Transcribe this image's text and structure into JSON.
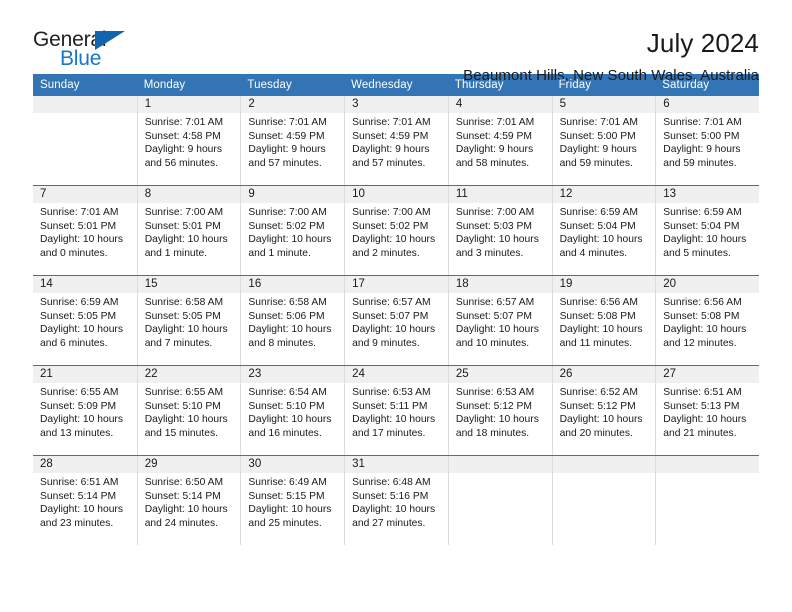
{
  "logo": {
    "word_top": "General",
    "word_bottom": "Blue",
    "triangle_color": "#1164ad",
    "blue_text_color": "#1878c8"
  },
  "header": {
    "month_title": "July 2024",
    "location": "Beaumont Hills, New South Wales, Australia",
    "header_bg_color": "#3274b4"
  },
  "weekdays": [
    "Sunday",
    "Monday",
    "Tuesday",
    "Wednesday",
    "Thursday",
    "Friday",
    "Saturday"
  ],
  "weeks": [
    [
      {
        "day": "",
        "info": ""
      },
      {
        "day": "1",
        "info": "Sunrise: 7:01 AM\nSunset: 4:58 PM\nDaylight: 9 hours\nand 56 minutes."
      },
      {
        "day": "2",
        "info": "Sunrise: 7:01 AM\nSunset: 4:59 PM\nDaylight: 9 hours\nand 57 minutes."
      },
      {
        "day": "3",
        "info": "Sunrise: 7:01 AM\nSunset: 4:59 PM\nDaylight: 9 hours\nand 57 minutes."
      },
      {
        "day": "4",
        "info": "Sunrise: 7:01 AM\nSunset: 4:59 PM\nDaylight: 9 hours\nand 58 minutes."
      },
      {
        "day": "5",
        "info": "Sunrise: 7:01 AM\nSunset: 5:00 PM\nDaylight: 9 hours\nand 59 minutes."
      },
      {
        "day": "6",
        "info": "Sunrise: 7:01 AM\nSunset: 5:00 PM\nDaylight: 9 hours\nand 59 minutes."
      }
    ],
    [
      {
        "day": "7",
        "info": "Sunrise: 7:01 AM\nSunset: 5:01 PM\nDaylight: 10 hours\nand 0 minutes."
      },
      {
        "day": "8",
        "info": "Sunrise: 7:00 AM\nSunset: 5:01 PM\nDaylight: 10 hours\nand 1 minute."
      },
      {
        "day": "9",
        "info": "Sunrise: 7:00 AM\nSunset: 5:02 PM\nDaylight: 10 hours\nand 1 minute."
      },
      {
        "day": "10",
        "info": "Sunrise: 7:00 AM\nSunset: 5:02 PM\nDaylight: 10 hours\nand 2 minutes."
      },
      {
        "day": "11",
        "info": "Sunrise: 7:00 AM\nSunset: 5:03 PM\nDaylight: 10 hours\nand 3 minutes."
      },
      {
        "day": "12",
        "info": "Sunrise: 6:59 AM\nSunset: 5:04 PM\nDaylight: 10 hours\nand 4 minutes."
      },
      {
        "day": "13",
        "info": "Sunrise: 6:59 AM\nSunset: 5:04 PM\nDaylight: 10 hours\nand 5 minutes."
      }
    ],
    [
      {
        "day": "14",
        "info": "Sunrise: 6:59 AM\nSunset: 5:05 PM\nDaylight: 10 hours\nand 6 minutes."
      },
      {
        "day": "15",
        "info": "Sunrise: 6:58 AM\nSunset: 5:05 PM\nDaylight: 10 hours\nand 7 minutes."
      },
      {
        "day": "16",
        "info": "Sunrise: 6:58 AM\nSunset: 5:06 PM\nDaylight: 10 hours\nand 8 minutes."
      },
      {
        "day": "17",
        "info": "Sunrise: 6:57 AM\nSunset: 5:07 PM\nDaylight: 10 hours\nand 9 minutes."
      },
      {
        "day": "18",
        "info": "Sunrise: 6:57 AM\nSunset: 5:07 PM\nDaylight: 10 hours\nand 10 minutes."
      },
      {
        "day": "19",
        "info": "Sunrise: 6:56 AM\nSunset: 5:08 PM\nDaylight: 10 hours\nand 11 minutes."
      },
      {
        "day": "20",
        "info": "Sunrise: 6:56 AM\nSunset: 5:08 PM\nDaylight: 10 hours\nand 12 minutes."
      }
    ],
    [
      {
        "day": "21",
        "info": "Sunrise: 6:55 AM\nSunset: 5:09 PM\nDaylight: 10 hours\nand 13 minutes."
      },
      {
        "day": "22",
        "info": "Sunrise: 6:55 AM\nSunset: 5:10 PM\nDaylight: 10 hours\nand 15 minutes."
      },
      {
        "day": "23",
        "info": "Sunrise: 6:54 AM\nSunset: 5:10 PM\nDaylight: 10 hours\nand 16 minutes."
      },
      {
        "day": "24",
        "info": "Sunrise: 6:53 AM\nSunset: 5:11 PM\nDaylight: 10 hours\nand 17 minutes."
      },
      {
        "day": "25",
        "info": "Sunrise: 6:53 AM\nSunset: 5:12 PM\nDaylight: 10 hours\nand 18 minutes."
      },
      {
        "day": "26",
        "info": "Sunrise: 6:52 AM\nSunset: 5:12 PM\nDaylight: 10 hours\nand 20 minutes."
      },
      {
        "day": "27",
        "info": "Sunrise: 6:51 AM\nSunset: 5:13 PM\nDaylight: 10 hours\nand 21 minutes."
      }
    ],
    [
      {
        "day": "28",
        "info": "Sunrise: 6:51 AM\nSunset: 5:14 PM\nDaylight: 10 hours\nand 23 minutes."
      },
      {
        "day": "29",
        "info": "Sunrise: 6:50 AM\nSunset: 5:14 PM\nDaylight: 10 hours\nand 24 minutes."
      },
      {
        "day": "30",
        "info": "Sunrise: 6:49 AM\nSunset: 5:15 PM\nDaylight: 10 hours\nand 25 minutes."
      },
      {
        "day": "31",
        "info": "Sunrise: 6:48 AM\nSunset: 5:16 PM\nDaylight: 10 hours\nand 27 minutes."
      },
      {
        "day": "",
        "info": ""
      },
      {
        "day": "",
        "info": ""
      },
      {
        "day": "",
        "info": ""
      }
    ]
  ]
}
